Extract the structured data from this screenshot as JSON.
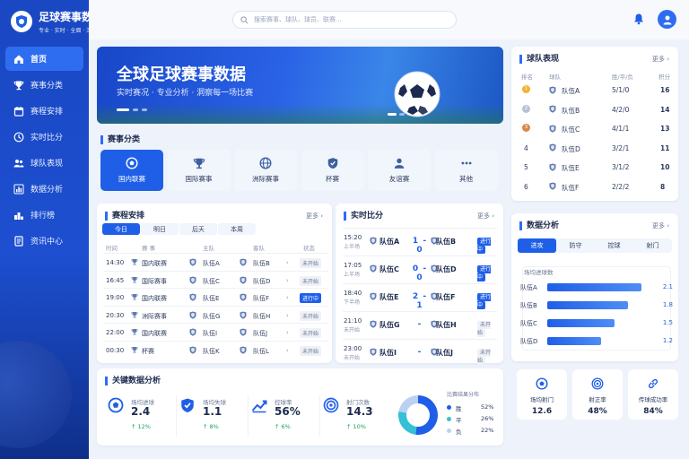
{
  "app": {
    "title": "足球赛事数据中心",
    "subtitle": "专业 · 实时 · 全面 · 深度"
  },
  "search": {
    "placeholder": "搜索赛事、球队、球员、联赛..."
  },
  "nav": [
    {
      "label": "首页",
      "icon": "home-icon",
      "active": true
    },
    {
      "label": "赛事分类",
      "icon": "trophy-icon"
    },
    {
      "label": "赛程安排",
      "icon": "calendar-icon"
    },
    {
      "label": "实时比分",
      "icon": "clock-icon"
    },
    {
      "label": "球队表现",
      "icon": "team-icon"
    },
    {
      "label": "数据分析",
      "icon": "bar-chart-icon"
    },
    {
      "label": "排行榜",
      "icon": "ranking-icon"
    },
    {
      "label": "资讯中心",
      "icon": "news-icon"
    }
  ],
  "banner": {
    "title": "全球足球赛事数据",
    "subtitle": "实时赛况 · 专业分析 · 洞察每一场比赛"
  },
  "categories": {
    "title": "赛事分类",
    "items": [
      {
        "label": "国内联赛",
        "icon": "soccer-ball-icon",
        "active": true
      },
      {
        "label": "国际赛事",
        "icon": "trophy-icon"
      },
      {
        "label": "洲际赛事",
        "icon": "globe-icon"
      },
      {
        "label": "杯赛",
        "icon": "shield-icon"
      },
      {
        "label": "友谊赛",
        "icon": "people-icon"
      },
      {
        "label": "其他",
        "icon": "more-icon"
      }
    ]
  },
  "schedule": {
    "title": "赛程安排",
    "more": "更多 ›",
    "tabs": [
      "今日",
      "明日",
      "后天",
      "本周"
    ],
    "columns": [
      "时间",
      "赛 事",
      "主队",
      "客队",
      "状态"
    ],
    "rows": [
      {
        "time": "14:30",
        "league": "国内联赛",
        "home": "队伍A",
        "away": "队伍B",
        "status": "未开始",
        "live": false
      },
      {
        "time": "16:45",
        "league": "国际赛事",
        "home": "队伍C",
        "away": "队伍D",
        "status": "未开始",
        "live": false
      },
      {
        "time": "19:00",
        "league": "国内联赛",
        "home": "队伍E",
        "away": "队伍F",
        "status": "进行中",
        "live": true
      },
      {
        "time": "20:30",
        "league": "洲际赛事",
        "home": "队伍G",
        "away": "队伍H",
        "status": "未开始",
        "live": false
      },
      {
        "time": "22:00",
        "league": "国内联赛",
        "home": "队伍I",
        "away": "队伍J",
        "status": "未开始",
        "live": false
      },
      {
        "time": "00:30",
        "league": "杯赛",
        "home": "队伍K",
        "away": "队伍L",
        "status": "未开始",
        "live": false
      }
    ]
  },
  "live": {
    "title": "实时比分",
    "more": "更多 ›",
    "matches": [
      {
        "time": "15:20",
        "half": "上半场",
        "home": "队伍A",
        "score": "1 - 0",
        "away": "队伍B",
        "status": "进行中",
        "live": true
      },
      {
        "time": "17:05",
        "half": "上半场",
        "home": "队伍C",
        "score": "0 - 0",
        "away": "队伍D",
        "status": "进行中",
        "live": true
      },
      {
        "time": "18:40",
        "half": "下半场",
        "home": "队伍E",
        "score": "2 - 1",
        "away": "队伍F",
        "status": "进行中",
        "live": true
      },
      {
        "time": "21:10",
        "half": "未开始",
        "home": "队伍G",
        "score": "-",
        "away": "队伍H",
        "status": "未开始",
        "live": false
      },
      {
        "time": "23:00",
        "half": "未开始",
        "home": "队伍I",
        "score": "-",
        "away": "队伍J",
        "status": "未开始",
        "live": false
      }
    ]
  },
  "key_stats": {
    "title": "关键数据分析",
    "items": [
      {
        "label": "场均进球",
        "value": "2.4",
        "delta": "↑ 12%",
        "icon": "soccer-ball-icon"
      },
      {
        "label": "场均失球",
        "value": "1.1",
        "delta": "↑ 8%",
        "icon": "shield-check-icon"
      },
      {
        "label": "控球率",
        "value": "56%",
        "delta": "↑ 6%",
        "icon": "trend-icon"
      },
      {
        "label": "射门次数",
        "value": "14.3",
        "delta": "↑ 10%",
        "icon": "target-icon"
      }
    ],
    "donut": {
      "title": "比赛结果分布",
      "slices": [
        {
          "label": "胜",
          "value": 52,
          "display": "52%",
          "color": "#1f5fe8"
        },
        {
          "label": "平",
          "value": 26,
          "display": "26%",
          "color": "#35c0d8"
        },
        {
          "label": "负",
          "value": 22,
          "display": "22%",
          "color": "#bcd0f2"
        }
      ]
    }
  },
  "team_perf": {
    "title": "球队表现",
    "more": "更多 ›",
    "columns": [
      "排名",
      "球队",
      "胜/平/负",
      "积分"
    ],
    "rows": [
      {
        "rank": "1",
        "team": "队伍A",
        "record": "5/1/0",
        "points": "16",
        "medal_color": "#f2b233"
      },
      {
        "rank": "2",
        "team": "队伍B",
        "record": "4/2/0",
        "points": "14",
        "medal_color": "#b7c2d6"
      },
      {
        "rank": "3",
        "team": "队伍C",
        "record": "4/1/1",
        "points": "13",
        "medal_color": "#d98a4a"
      },
      {
        "rank": "4",
        "team": "队伍D",
        "record": "3/2/1",
        "points": "11",
        "medal_color": ""
      },
      {
        "rank": "5",
        "team": "队伍E",
        "record": "3/1/2",
        "points": "10",
        "medal_color": ""
      },
      {
        "rank": "6",
        "team": "队伍F",
        "record": "2/2/2",
        "points": "8",
        "medal_color": ""
      }
    ]
  },
  "analysis": {
    "title": "数据分析",
    "more": "更多 ›",
    "tabs": [
      "进攻",
      "防守",
      "控球",
      "射门"
    ],
    "chart_title": "场均进球数",
    "chart_data": {
      "type": "bar",
      "title": "场均进球数",
      "categories": [
        "队伍A",
        "队伍B",
        "队伍C",
        "队伍D"
      ],
      "values": [
        2.1,
        1.8,
        1.5,
        1.2
      ],
      "labels": [
        "2.1",
        "1.8",
        "1.5",
        "1.2"
      ],
      "xlim": [
        0,
        2.2
      ]
    },
    "mini_stats": [
      {
        "label": "场均射门",
        "value": "12.6",
        "icon": "soccer-ball-icon"
      },
      {
        "label": "射正率",
        "value": "48%",
        "icon": "target-icon"
      },
      {
        "label": "传球成功率",
        "value": "84%",
        "icon": "link-icon"
      }
    ]
  }
}
